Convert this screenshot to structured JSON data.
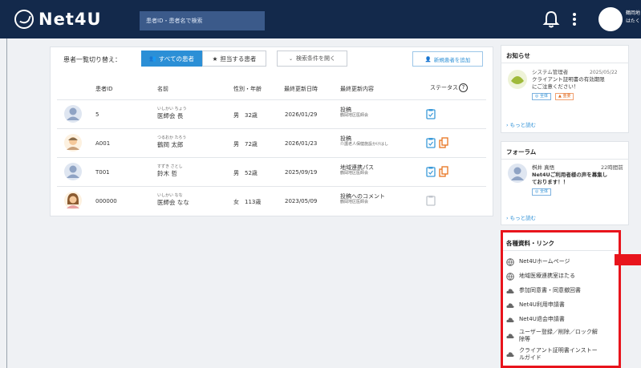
{
  "header": {
    "brand": "Net4U",
    "search_placeholder": "患者ID・患者名で検索",
    "user_name_line1": "鶴岡地",
    "user_name_line2": "はたく"
  },
  "patients": {
    "switch_label": "患者一覧切り替え：",
    "tab_all_label": "すべての患者",
    "tab_assigned_label": "担当する患者",
    "filter_label": "検索条件を開く",
    "add_label": "新規患者を追加",
    "columns": [
      "患者ID",
      "名前",
      "性別・年齢",
      "最終更新日時",
      "最終更新内容",
      "ステータス"
    ],
    "rows": [
      {
        "id": "5",
        "kana": "いしかい ちょう",
        "name": "医師会 長",
        "gender_age": "男　32歳",
        "updated": "2026/01/29",
        "content": "投稿",
        "content_sub": "鶴岡地区医師会",
        "status": "single"
      },
      {
        "id": "A001",
        "kana": "つるおか たろう",
        "name": "鶴岡 太郎",
        "gender_age": "男　72歳",
        "updated": "2026/01/23",
        "content": "投稿",
        "content_sub": "介護老人保健施設かけはし",
        "status": "double"
      },
      {
        "id": "T001",
        "kana": "すずき さとし",
        "name": "鈴木 哲",
        "gender_age": "男　52歳",
        "updated": "2025/09/19",
        "content": "地域連携パス",
        "content_sub": "鶴岡地区医師会",
        "status": "double"
      },
      {
        "id": "000000",
        "kana": "いしかい なな",
        "name": "医師会 なな",
        "gender_age": "女　113歳",
        "updated": "2023/05/09",
        "content": "投稿へのコメント",
        "content_sub": "鶴岡地区医師会",
        "status": "gray"
      }
    ]
  },
  "notice": {
    "title": "お知らせ",
    "author": "システム管理者",
    "date": "2025/05/22",
    "line1": "クライアント証明書の有効期限",
    "line2": "にご注意ください！",
    "tag1": "全体",
    "tag2": "重要",
    "more": "もっと読む"
  },
  "forum": {
    "title": "フォーラム",
    "author": "桝井 真悟",
    "time": "22時間前",
    "line1": "Net4Uご利用者様の声を募集し",
    "line2": "ております！！",
    "tag": "全体",
    "more": "もっと読む"
  },
  "links": {
    "title": "各種資料・リンク",
    "items": [
      {
        "label": "Net4Uホームページ",
        "icon": "globe-icon"
      },
      {
        "label": "地域医療連携室ほたる",
        "icon": "globe-icon"
      },
      {
        "label": "参加同意書・同意撤回書",
        "icon": "cloud-icon"
      },
      {
        "label": "Net4U利用申請書",
        "icon": "cloud-icon"
      },
      {
        "label": "Net4U退会申請書",
        "icon": "cloud-icon"
      },
      {
        "label": "ユーザー登録／削除／ロック解",
        "label2": "除等",
        "icon": "cloud-icon"
      },
      {
        "label": "クライアント証明書インストー",
        "label2": "ルガイド",
        "icon": "cloud-icon"
      }
    ]
  },
  "colors": {
    "header_bg": "#13294b",
    "accent": "#2b8fd6",
    "highlight_red": "#e8141c"
  }
}
